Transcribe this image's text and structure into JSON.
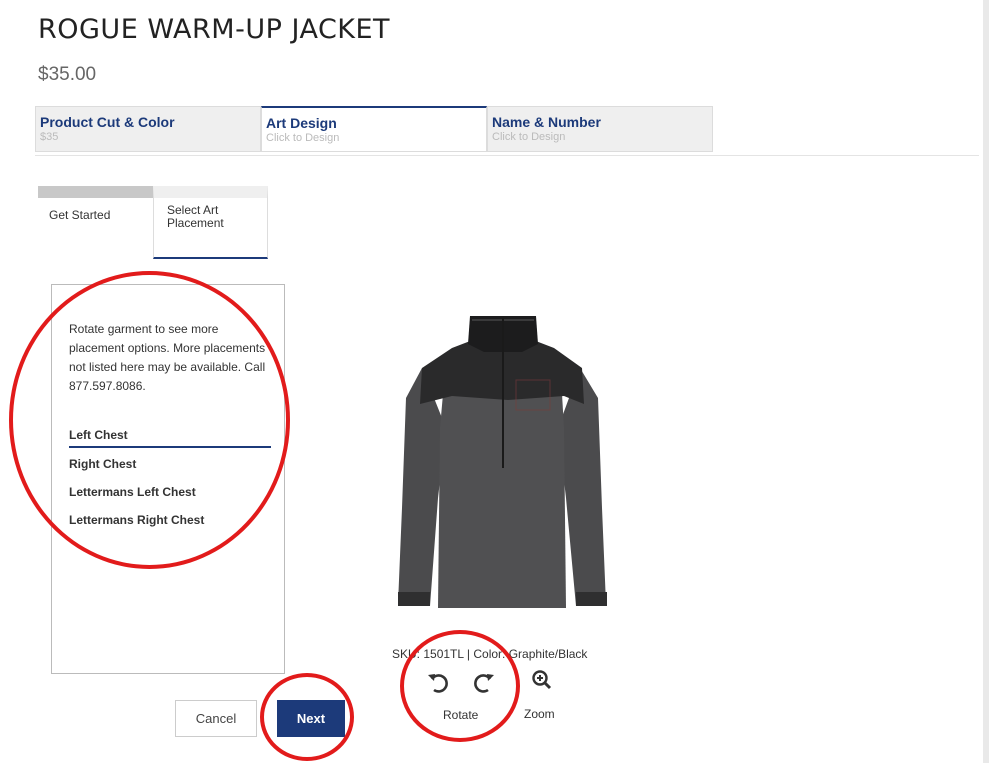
{
  "product": {
    "title": "ROGUE WARM-UP JACKET",
    "price": "$35.00"
  },
  "steps": [
    {
      "label": "Product Cut & Color",
      "sub": "$35"
    },
    {
      "label": "Art Design",
      "sub": "Click to Design"
    },
    {
      "label": "Name & Number",
      "sub": "Click to Design"
    }
  ],
  "subtabs": {
    "get_started": "Get Started",
    "select_art_placement": "Select Art Placement"
  },
  "panel": {
    "instructions": "Rotate garment to see more placement options. More placements not listed here may be available. Call 877.597.8086.",
    "placements": [
      "Left Chest",
      "Right Chest",
      "Lettermans Left Chest",
      "Lettermans Right Chest"
    ],
    "selected": "Left Chest"
  },
  "buttons": {
    "cancel": "Cancel",
    "next": "Next"
  },
  "garment": {
    "sku_line": "SKU: 1501TL  |  Color: Graphite/Black",
    "sku": "1501TL",
    "color": "Graphite/Black"
  },
  "controls": {
    "rotate_label": "Rotate",
    "zoom_label": "Zoom",
    "icons": [
      "rotate-left-icon",
      "rotate-right-icon",
      "zoom-in-icon"
    ]
  },
  "colors": {
    "accent": "#1c3a7a",
    "annotation": "#e21b1b"
  }
}
